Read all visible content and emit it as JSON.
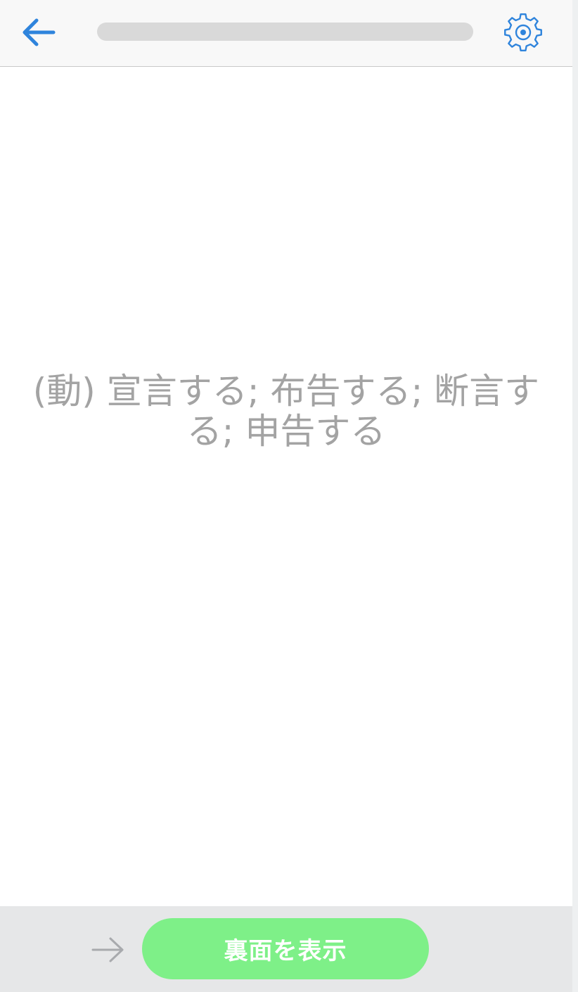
{
  "header": {
    "back_icon": "arrow-left-icon",
    "settings_icon": "gear-icon",
    "progress": 0,
    "accent_color": "#2f84dc"
  },
  "card": {
    "text": "(動)  宣言する; 布告する; 断言する; 申告する"
  },
  "footer": {
    "next_icon": "arrow-right-icon",
    "show_back_label": "裏面を表示",
    "button_color": "#7ef088"
  }
}
